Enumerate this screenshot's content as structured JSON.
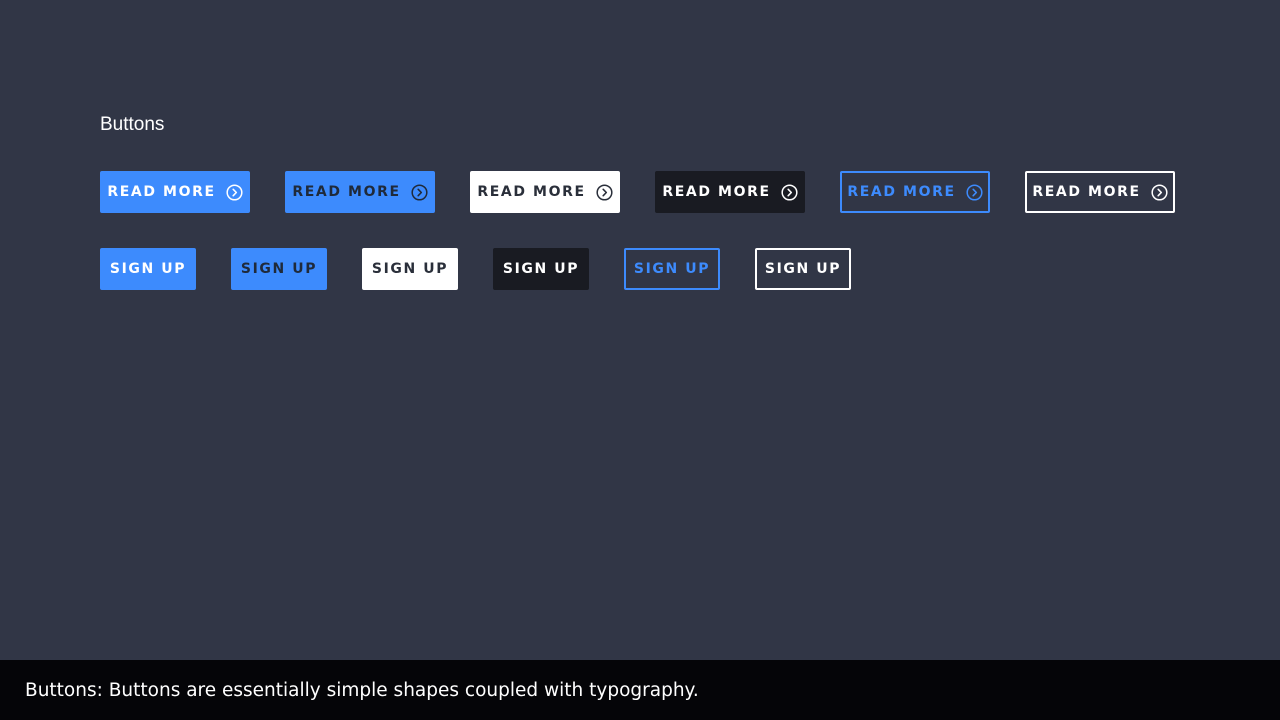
{
  "section": {
    "title": "Buttons"
  },
  "read_more_buttons": [
    {
      "label": "READ MORE",
      "variant": "blue",
      "icon": "chevron-right-circle-icon"
    },
    {
      "label": "READ MORE",
      "variant": "blue-dark-text",
      "icon": "chevron-right-circle-icon"
    },
    {
      "label": "READ MORE",
      "variant": "white",
      "icon": "chevron-right-circle-icon"
    },
    {
      "label": "READ MORE",
      "variant": "black",
      "icon": "chevron-right-circle-icon"
    },
    {
      "label": "READ MORE",
      "variant": "blue-outline",
      "icon": "chevron-right-circle-icon"
    },
    {
      "label": "READ MORE",
      "variant": "white-outline",
      "icon": "chevron-right-circle-icon"
    }
  ],
  "sign_up_buttons": [
    {
      "label": "SIGN UP",
      "variant": "blue"
    },
    {
      "label": "SIGN UP",
      "variant": "blue-dark-text"
    },
    {
      "label": "SIGN UP",
      "variant": "white"
    },
    {
      "label": "SIGN UP",
      "variant": "black"
    },
    {
      "label": "SIGN UP",
      "variant": "blue-outline"
    },
    {
      "label": "SIGN UP",
      "variant": "white-outline"
    }
  ],
  "caption": {
    "text": "Buttons: Buttons are essentially simple shapes coupled with typography."
  },
  "colors": {
    "background": "#313646",
    "accent_blue": "#3d8bfd",
    "dark_button": "#191b22",
    "caption_bar": "#050508"
  }
}
